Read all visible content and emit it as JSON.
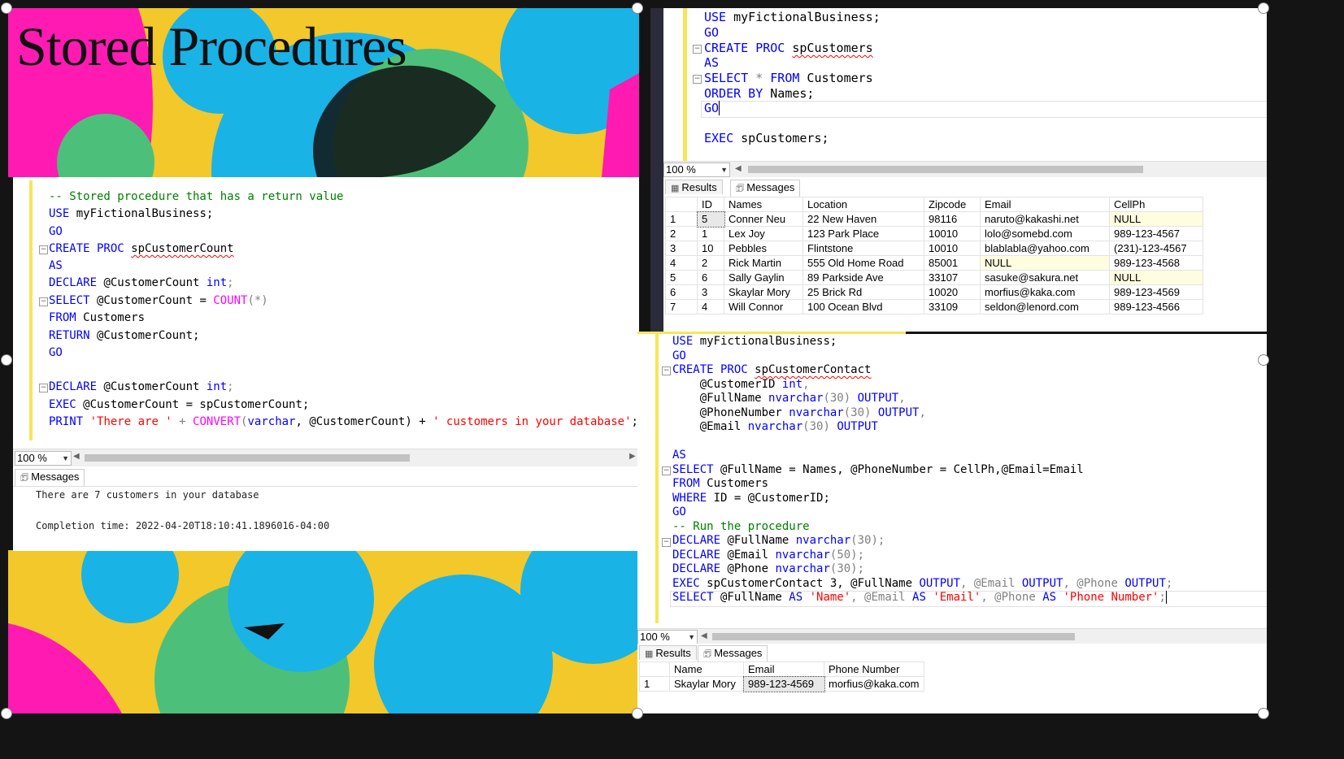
{
  "slide_title": "Stored Procedures",
  "colors": {
    "yellow": "#f2c82a",
    "cyan": "#1ab3e6",
    "green": "#4cc07a",
    "magenta": "#ff1ab2",
    "keyword": "#0000ff",
    "string": "#ff0000",
    "comment": "#008000",
    "function": "#ff00ff"
  },
  "left_editor": {
    "lines": [
      {
        "cm": "-- Stored procedure that has a return value"
      },
      {
        "kw": "USE",
        "t": " myFictionalBusiness;"
      },
      {
        "kw": "GO"
      },
      {
        "kw": "CREATE PROC",
        "t": " ",
        "sq": "spCustomerCount"
      },
      {
        "kw": "AS"
      },
      {
        "kw": "DECLARE",
        "t": " @CustomerCount ",
        "kw2": "int",
        ";": ";"
      },
      {
        "kw": "SELECT",
        "t": " @CustomerCount = ",
        "fn": "COUNT",
        "t2": "(*)"
      },
      {
        "kw": "FROM",
        "t": " Customers"
      },
      {
        "kw": "RETURN",
        "t": " @CustomerCount;"
      },
      {
        "kw": "GO"
      },
      {},
      {
        "kw": "DECLARE",
        "t": " @CustomerCount ",
        "kw2": "int",
        ";": ";"
      },
      {
        "kw": "EXEC",
        "t": " @CustomerCount = spCustomerCount;"
      },
      {
        "kw": "PRINT",
        "str": " 'There are '",
        "t": " + ",
        "fn": "CONVERT",
        "t2": "(",
        "kw2": "varchar",
        "t3": ", @CustomerCount) + ",
        "str2": "' customers in your database'",
        ";": ";"
      }
    ],
    "zoom": "100 %",
    "messages_tab": "Messages",
    "message_line1": "There are 7 customers in your database",
    "message_line2": "Completion time: 2022-04-20T18:10:41.1896016-04:00"
  },
  "top_right_editor": {
    "line1_kw": "USE",
    "line1_t": " myFictionalBusiness;",
    "line2": "GO",
    "line3_kw": "CREATE PROC",
    "line3_sq": "spCustomers",
    "line4": "AS",
    "line5_kw": "SELECT",
    "line5_t": " * ",
    "line5_kw2": "FROM",
    "line5_t2": " Customers",
    "line6_kw": "ORDER BY",
    "line6_t": " Names;",
    "line7": "GO",
    "line8_kw": "EXEC",
    "line8_t": " spCustomers;",
    "zoom": "100 %",
    "results_tab": "Results",
    "messages_tab": "Messages",
    "columns": [
      "ID",
      "Names",
      "Location",
      "Zipcode",
      "Email",
      "CellPh"
    ],
    "rows": [
      [
        "1",
        "5",
        "Conner Neu",
        "22 New Haven",
        "98116",
        "naruto@kakashi.net",
        "NULL"
      ],
      [
        "2",
        "1",
        "Lex Joy",
        "123 Park Place",
        "10010",
        "lolo@somebd.com",
        "989-123-4567"
      ],
      [
        "3",
        "10",
        "Pebbles",
        "Flintstone",
        "10010",
        "blablabla@yahoo.com",
        "(231)-123-4567"
      ],
      [
        "4",
        "2",
        "Rick Martin",
        "555 Old Home Road",
        "85001",
        "NULL",
        "989-123-4568"
      ],
      [
        "5",
        "6",
        "Sally Gaylin",
        "89 Parkside Ave",
        "33107",
        "sasuke@sakura.net",
        "NULL"
      ],
      [
        "6",
        "3",
        "Skaylar Mory",
        "25 Brick Rd",
        "10020",
        "morfius@kaka.com",
        "989-123-4569"
      ],
      [
        "7",
        "4",
        "Will Connor",
        "100 Ocean Blvd",
        "33109",
        "seldon@lenord.com",
        "989-123-4566"
      ]
    ]
  },
  "bottom_right_editor": {
    "l1_kw": "USE",
    "l1_t": " myFictionalBusiness;",
    "l2": "GO",
    "l3_kw": "CREATE PROC",
    "l3_sq": "spCustomerContact",
    "l4_t": "    @CustomerID ",
    "l4_kw": "int",
    "l5_t": "    @FullName ",
    "l5_kw": "nvarchar",
    "l5_t2": "(30) ",
    "l5_kw2": "OUTPUT",
    "l6_t": "    @PhoneNumber ",
    "l6_kw": "nvarchar",
    "l6_t2": "(30) ",
    "l6_kw2": "OUTPUT",
    "l7_t": "    @Email ",
    "l7_kw": "nvarchar",
    "l7_t2": "(30) ",
    "l7_kw2": "OUTPUT",
    "l8": "AS",
    "l9_kw": "SELECT",
    "l9_t": " @FullName = Names, @PhoneNumber = CellPh,@Email=Email",
    "l10_kw": "FROM",
    "l10_t": " Customers",
    "l11_kw": "WHERE",
    "l11_t": " ID = @CustomerID;",
    "l12": "GO",
    "l13_cm": "-- Run the procedure",
    "l14_kw": "DECLARE",
    "l14_t": " @FullName ",
    "l14_kw2": "nvarchar",
    "l14_t2": "(30);",
    "l15_kw": "DECLARE",
    "l15_t": " @Email ",
    "l15_kw2": "nvarchar",
    "l15_t2": "(50);",
    "l16_kw": "DECLARE",
    "l16_t": " @Phone ",
    "l16_kw2": "nvarchar",
    "l16_t2": "(30);",
    "l17_kw": "EXEC",
    "l17_t": " spCustomerContact 3, @FullName ",
    "l17_kw2": "OUTPUT",
    "l17_t2": ", @Email ",
    "l17_kw3": "OUTPUT",
    "l17_t3": ", @Phone ",
    "l17_kw4": "OUTPUT",
    "l17_t4": ";",
    "l18_kw": "SELECT",
    "l18_t": " @FullName ",
    "l18_kw2": "AS",
    "l18_s1": " 'Name'",
    "l18_t2": ", @Email ",
    "l18_kw3": "AS",
    "l18_s2": " 'Email'",
    "l18_t3": ", @Phone ",
    "l18_kw4": "AS",
    "l18_s3": " 'Phone Number'",
    "l18_t4": ";",
    "zoom": "100 %",
    "results_tab": "Results",
    "messages_tab": "Messages",
    "columns": [
      "Name",
      "Email",
      "Phone Number"
    ],
    "row": [
      "1",
      "Skaylar Mory",
      "989-123-4569",
      "morfius@kaka.com"
    ]
  }
}
